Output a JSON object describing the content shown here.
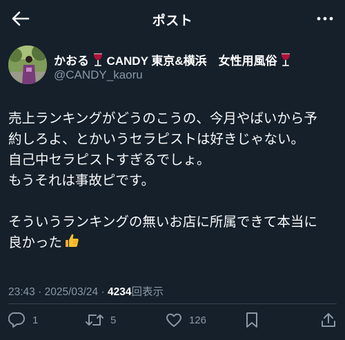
{
  "header": {
    "title": "ポスト"
  },
  "author": {
    "display_name_part1": "かおる",
    "display_name_part2": "CANDY 東京&横浜　女性用風俗",
    "handle": "@CANDY_kaoru"
  },
  "post": {
    "lines": [
      "売上ランキングがどうのこうの、今月やばいから予",
      "約しろよ、とかいうセラピストは好きじゃない。",
      "自己中セラピストすぎるでしょ。",
      "もうそれは事故ピです。",
      "",
      "そういうランキングの無いお店に所属できて本当に",
      "良かった"
    ]
  },
  "meta": {
    "time": "23:43",
    "separator1": "·",
    "date": "2025/03/24",
    "separator2": "·",
    "views_count": "4234",
    "views_label": "回表示"
  },
  "actions": {
    "reply_count": "1",
    "retweet_count": "5",
    "like_count": "126"
  },
  "colors": {
    "background": "#15202b",
    "secondary_text": "#8b98a5",
    "divider": "#38444d"
  },
  "icons": {
    "back": "arrow-left-icon",
    "more": "more-horizontal-icon",
    "wine": "wine-glass-icon",
    "thumbs_up": "thumbs-up-icon",
    "reply": "reply-icon",
    "retweet": "retweet-icon",
    "like": "heart-icon",
    "bookmark": "bookmark-icon",
    "share": "share-icon"
  }
}
